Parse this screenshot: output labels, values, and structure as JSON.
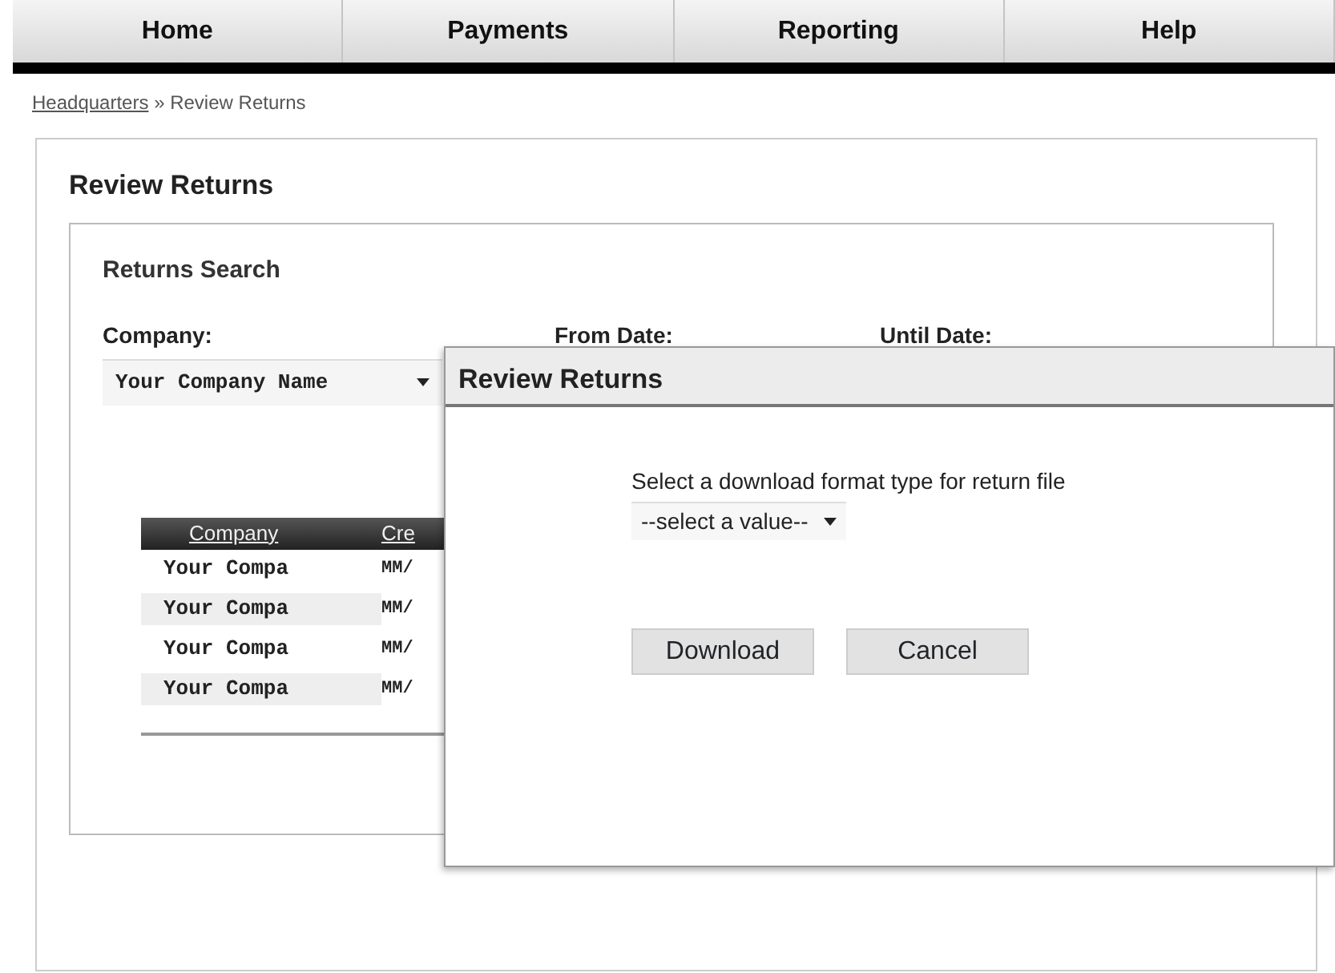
{
  "nav": [
    {
      "label": "Home",
      "selected": false
    },
    {
      "label": "Payments",
      "selected": false
    },
    {
      "label": "Reporting",
      "selected": false
    },
    {
      "label": "Help",
      "selected": false
    }
  ],
  "breadcrumb": {
    "link": "Headquarters",
    "separator": "»",
    "current": "Review Returns"
  },
  "page_title": "Review Returns",
  "search": {
    "title": "Returns Search",
    "company_label": "Company:",
    "company_value": "Your Company Name",
    "from_label": "From Date:",
    "until_label": "Until Date:"
  },
  "table": {
    "columns": [
      "Company",
      "Cre"
    ],
    "rows": [
      [
        "Your Compa",
        "MM/"
      ],
      [
        "Your Compa",
        "MM/"
      ],
      [
        "Your Compa",
        "MM/"
      ],
      [
        "Your Compa",
        "MM/"
      ]
    ]
  },
  "dialog": {
    "title": "Review Returns",
    "prompt": "Select a download format type for return file",
    "select_value": "--select a value--",
    "buttons": [
      "Download",
      "Cancel"
    ]
  }
}
